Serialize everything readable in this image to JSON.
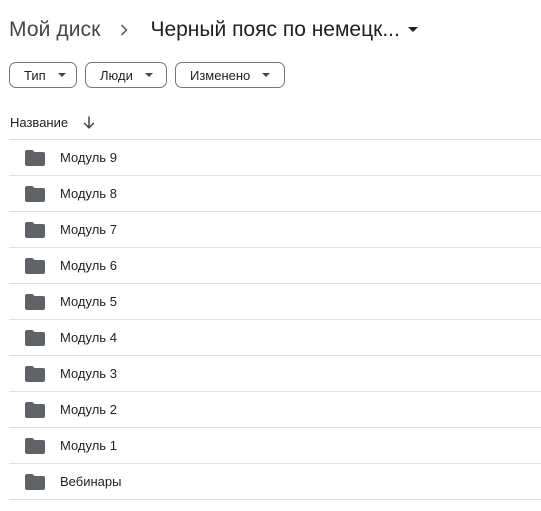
{
  "breadcrumb": {
    "root": "Мой диск",
    "current": "Черный пояс по немецк..."
  },
  "filters": [
    {
      "label": "Тип"
    },
    {
      "label": "Люди"
    },
    {
      "label": "Изменено"
    }
  ],
  "list": {
    "column_header": "Название",
    "sort": "descending",
    "items": [
      {
        "name": "Модуль 9",
        "icon": "folder-icon"
      },
      {
        "name": "Модуль 8",
        "icon": "folder-icon"
      },
      {
        "name": "Модуль 7",
        "icon": "folder-icon"
      },
      {
        "name": "Модуль 6",
        "icon": "folder-icon"
      },
      {
        "name": "Модуль 5",
        "icon": "folder-icon"
      },
      {
        "name": "Модуль 4",
        "icon": "folder-icon"
      },
      {
        "name": "Модуль 3",
        "icon": "folder-icon"
      },
      {
        "name": "Модуль 2",
        "icon": "folder-icon"
      },
      {
        "name": "Модуль 1",
        "icon": "folder-icon"
      },
      {
        "name": "Вебинары",
        "icon": "folder-icon"
      }
    ]
  },
  "colors": {
    "folder": "#5f6368",
    "divider": "#e0e0e0",
    "chip_border": "#747775"
  }
}
